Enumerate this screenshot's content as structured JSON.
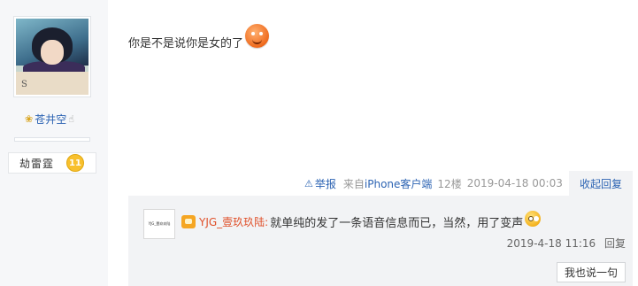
{
  "user": {
    "avatar_mark": "S",
    "username": "苍井空",
    "badge_name": "劫雷霆",
    "badge_level": "11"
  },
  "post": {
    "text": "你是不是说你是女的了",
    "emoji_icon": "smile-emoji-icon"
  },
  "meta": {
    "report_label": "举报",
    "source_prefix": "来自",
    "source_client": "iPhone客户端",
    "floor": "12楼",
    "time": "2019-04-18 00:03",
    "collapse_label": "收起回复"
  },
  "reply": {
    "avatar_text": "YJG_壹玖玖陆",
    "author": "YJG_壹玖玖陆",
    "colon": ":",
    "text": "就单纯的发了一条语音信息而已，当然，用了变声",
    "time": "2019-4-18 11:16",
    "reply_label": "回复",
    "say_button": "我也说一句"
  },
  "colors": {
    "link": "#2d64b3",
    "reply_author": "#e0502a",
    "reply_bg": "#f2f3f5"
  }
}
